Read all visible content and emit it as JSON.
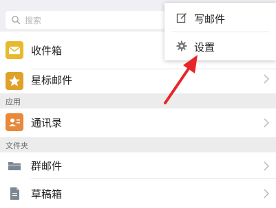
{
  "search": {
    "placeholder": "搜索"
  },
  "mailboxes": {
    "items": [
      {
        "label": "收件箱",
        "icon": "envelope-icon",
        "color": "#e7b92e"
      },
      {
        "label": "星标邮件",
        "icon": "star-icon",
        "color": "#e0a12a"
      }
    ]
  },
  "apps": {
    "header": "应用",
    "items": [
      {
        "label": "通讯录",
        "icon": "contact-card-icon",
        "color": "#e8893c"
      }
    ]
  },
  "folders": {
    "header": "文件夹",
    "items": [
      {
        "label": "群邮件",
        "icon": "folder-icon",
        "color": "#7c8794"
      },
      {
        "label": "草稿箱",
        "icon": "draft-icon",
        "color": "#7c8794"
      }
    ]
  },
  "popup_menu": {
    "items": [
      {
        "label": "写邮件",
        "icon": "compose-icon"
      },
      {
        "label": "设置",
        "icon": "gear-icon"
      }
    ]
  },
  "annotation": {
    "arrow_color": "#e8252a"
  }
}
